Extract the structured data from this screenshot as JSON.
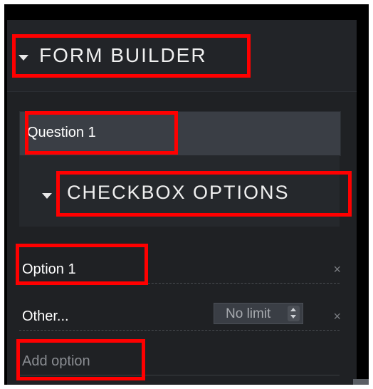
{
  "form_builder": {
    "title": "FORM BUILDER",
    "question": {
      "label": "Question 1"
    },
    "checkbox_options": {
      "title": "CHECKBOX OPTIONS",
      "options": [
        {
          "label": "Option 1"
        },
        {
          "label": "Other...",
          "limit": "No limit"
        }
      ],
      "add_option_label": "Add option"
    }
  },
  "colors": {
    "panel_bg": "#1f2124",
    "input_bg": "#3a3e45",
    "highlight": "#ff0000",
    "text": "#ffffff",
    "muted_text": "#8a8d92"
  }
}
